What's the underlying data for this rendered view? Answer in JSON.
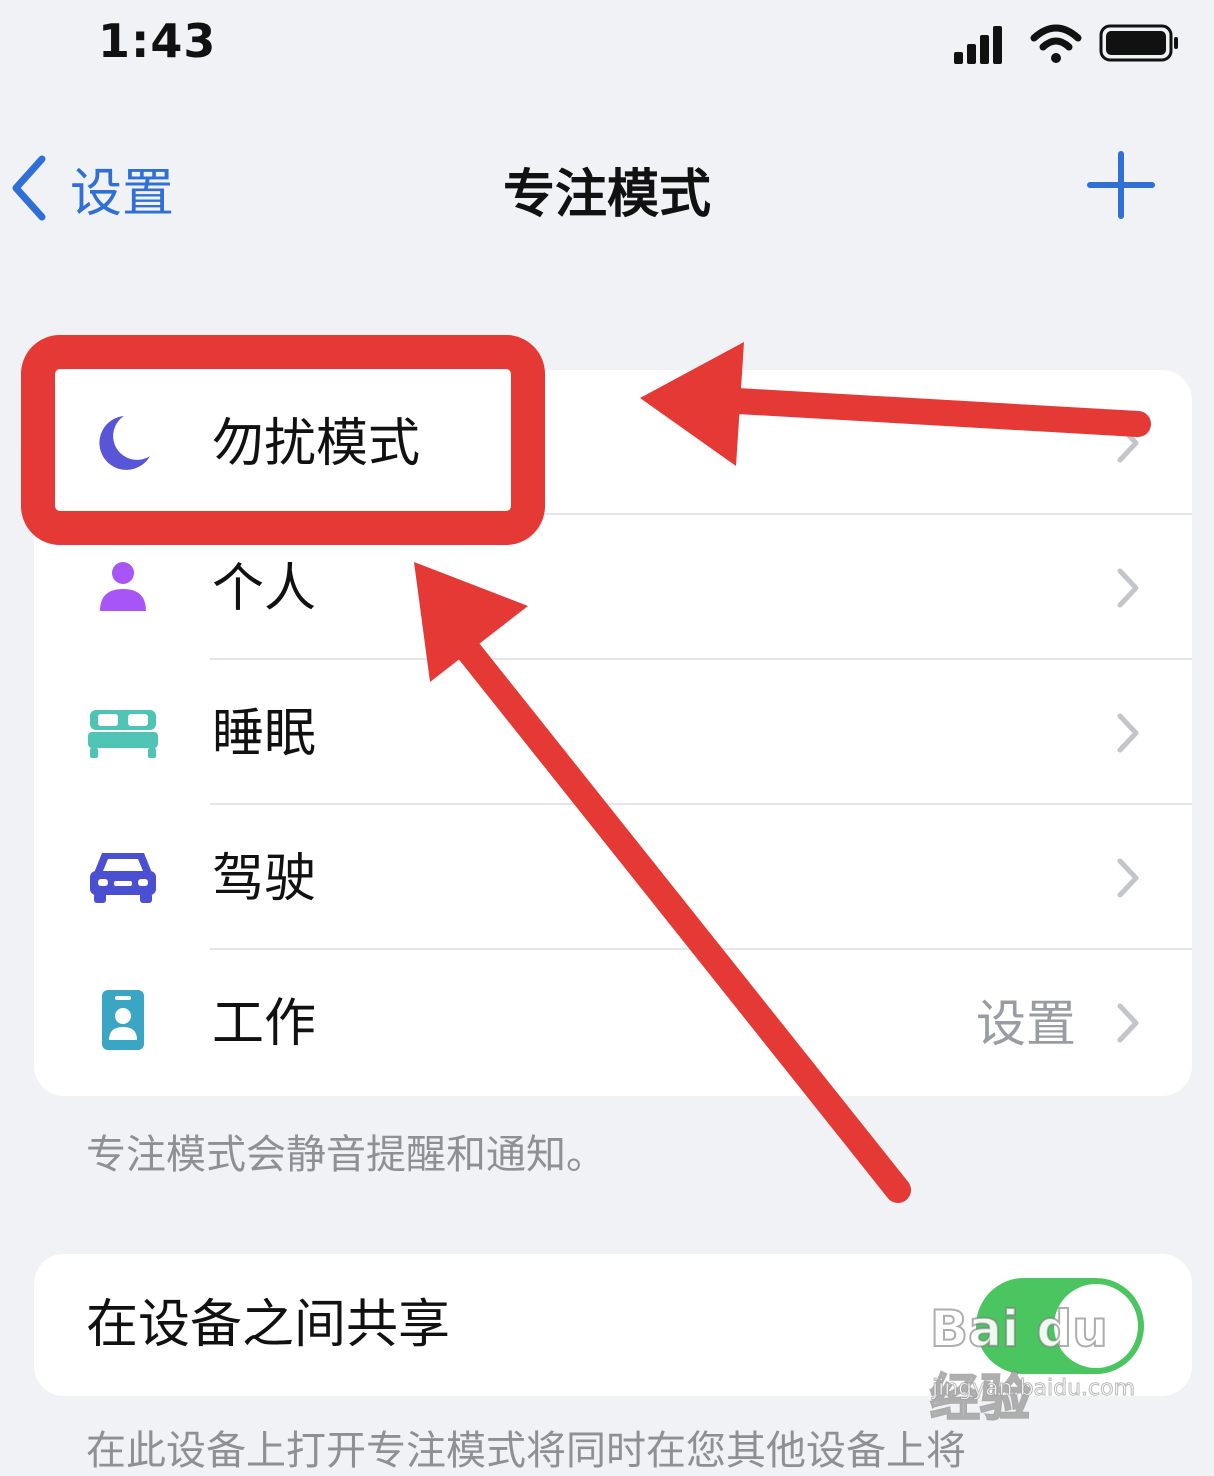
{
  "status_bar": {
    "time": "1:43",
    "icons": [
      "cellular-signal-icon",
      "wifi-icon",
      "battery-icon"
    ]
  },
  "nav": {
    "back_label": "设置",
    "title": "专注模式",
    "add_icon": "plus-icon",
    "accent_color": "#2f6fd6"
  },
  "focus_modes": [
    {
      "label": "勿扰模式",
      "icon": "moon-icon",
      "color": "#5856d6",
      "value": ""
    },
    {
      "label": "个人",
      "icon": "person-icon",
      "color": "#a855f7",
      "value": ""
    },
    {
      "label": "睡眠",
      "icon": "bed-icon",
      "color": "#4fc3b4",
      "value": ""
    },
    {
      "label": "驾驶",
      "icon": "car-icon",
      "color": "#4b4fd1",
      "value": ""
    },
    {
      "label": "工作",
      "icon": "id-badge-icon",
      "color": "#3aa6c4",
      "value": "设置"
    }
  ],
  "footnote": "专注模式会静音提醒和通知。",
  "share": {
    "label": "在设备之间共享",
    "toggle_on": true,
    "toggle_color": "#4bc560"
  },
  "bottom_text": "在此设备上打开专注模式将同时在您其他设备上将",
  "annotation": {
    "color": "#e53935",
    "highlighted_item": "勿扰模式"
  },
  "watermark": {
    "logo": "Bai du 经验",
    "url": "jingyan.baidu.com"
  }
}
